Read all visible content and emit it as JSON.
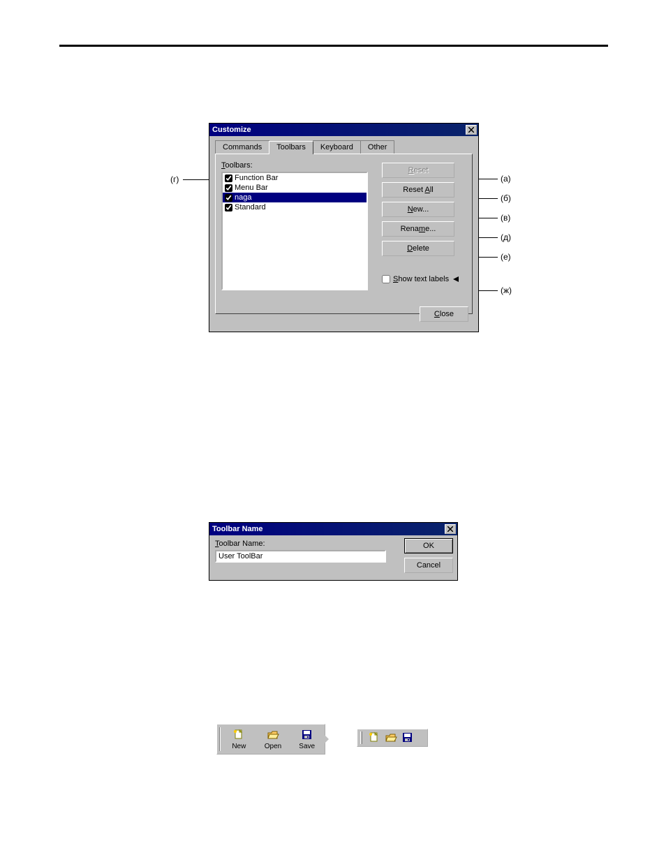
{
  "callouts": {
    "left1": "(г)",
    "r1": "(а)",
    "r2": "(б)",
    "r3": "(в)",
    "r4": "(д)",
    "r5": "(е)",
    "r6": "(ж)"
  },
  "customize": {
    "title": "Customize",
    "tabs": {
      "commands": "Commands",
      "toolbars": "Toolbars",
      "keyboard": "Keyboard",
      "other": "Other"
    },
    "toolbars_label": "Toolbars:",
    "toolbars_hotkey": "T",
    "items": [
      {
        "label": "Function Bar",
        "checked": true,
        "selected": false
      },
      {
        "label": "Menu Bar",
        "checked": true,
        "selected": false
      },
      {
        "label": "naga",
        "checked": true,
        "selected": true
      },
      {
        "label": "Standard",
        "checked": true,
        "selected": false
      }
    ],
    "buttons": {
      "reset": "Reset",
      "reset_hotkey": "R",
      "reset_all": "Reset All",
      "reset_all_hotkey": "A",
      "new": "New...",
      "new_hotkey": "N",
      "rename": "Rename...",
      "rename_hotkey": "m",
      "delete": "Delete",
      "delete_hotkey": "D"
    },
    "show_text_labels": "Show text labels",
    "show_text_hotkey": "S",
    "close": "Close",
    "close_hotkey": "C"
  },
  "toolbar_name_dialog": {
    "title": "Toolbar Name",
    "label": "Toolbar Name:",
    "label_hotkey": "T",
    "value": "User ToolBar",
    "ok": "OK",
    "cancel": "Cancel"
  },
  "toolbar_examples": {
    "items": [
      {
        "icon": "new-doc-icon",
        "label": "New"
      },
      {
        "icon": "open-folder-icon",
        "label": "Open"
      },
      {
        "icon": "save-disk-icon",
        "label": "Save"
      }
    ]
  }
}
